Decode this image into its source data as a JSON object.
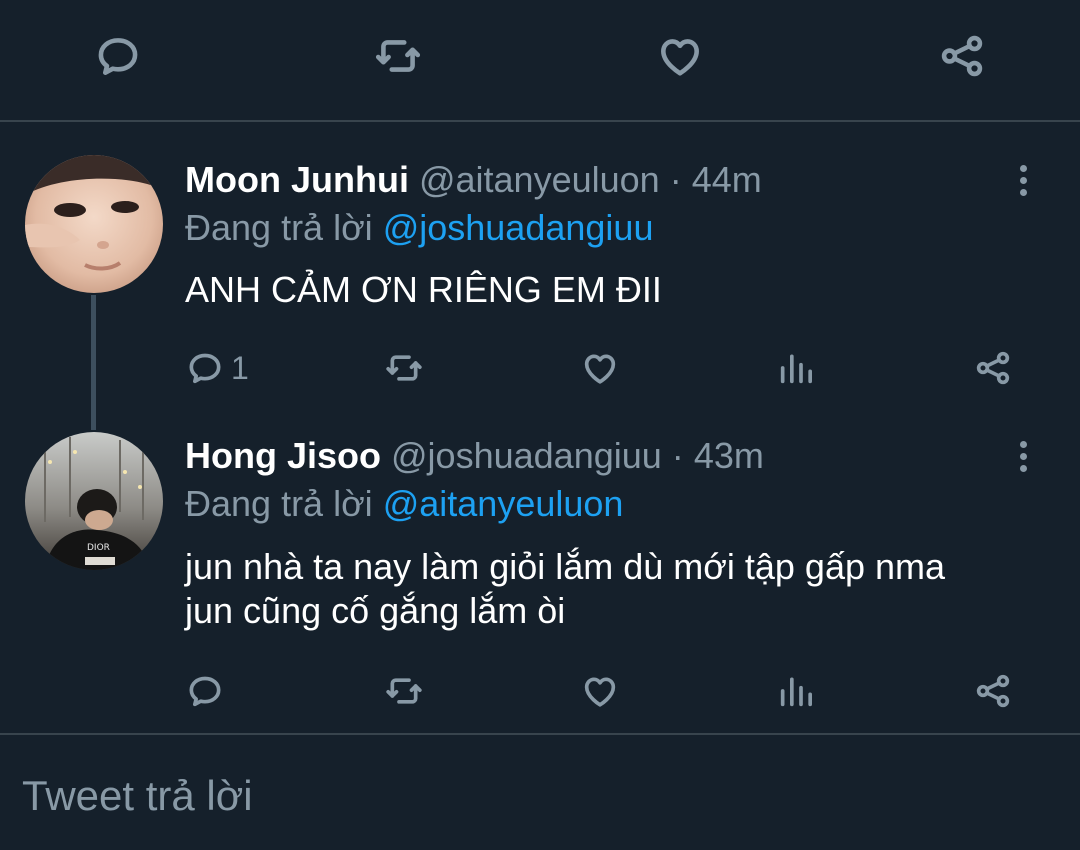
{
  "colors": {
    "background": "#15202b",
    "divider": "#38444d",
    "muted": "#8899a6",
    "accent": "#1da1f2",
    "text": "#ffffff"
  },
  "top_actions": {
    "icons": [
      "reply-icon",
      "retweet-icon",
      "like-icon",
      "share-icon"
    ]
  },
  "tweets": [
    {
      "name": "Moon Junhui",
      "handle": "@aitanyeuluon",
      "sep": "·",
      "time": "44m",
      "replying_prefix": "Đang trả lời",
      "replying_to": "@joshuadangiuu",
      "text": "ANH CẢM ƠN RIÊNG EM ĐII",
      "reply_count": "1",
      "icons": [
        "reply-icon",
        "retweet-icon",
        "like-icon",
        "analytics-icon",
        "share-icon"
      ]
    },
    {
      "name": "Hong Jisoo",
      "handle": "@joshuadangiuu",
      "sep": "·",
      "time": "43m",
      "replying_prefix": "Đang trả lời",
      "replying_to": "@aitanyeuluon",
      "text_line1": "jun nhà ta nay làm giỏi lắm dù mới tập gấp nma",
      "text_line2": "jun cũng cố gắng lắm òi",
      "reply_count": "",
      "icons": [
        "reply-icon",
        "retweet-icon",
        "like-icon",
        "analytics-icon",
        "share-icon"
      ]
    }
  ],
  "composer": {
    "placeholder": "Tweet trả lời"
  }
}
